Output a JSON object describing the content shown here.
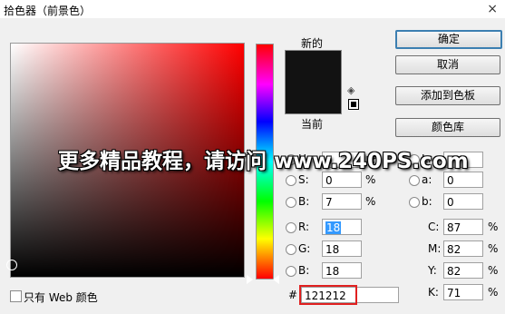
{
  "window": {
    "title": "拾色器（前景色）",
    "close_glyph": "×"
  },
  "preview": {
    "new_label": "新的",
    "current_label": "当前",
    "new_color": "#121212",
    "current_color": "#121212"
  },
  "buttons": {
    "ok": "确定",
    "cancel": "取消",
    "add_swatch": "添加到色板",
    "libraries": "颜色库"
  },
  "hsb": {
    "h_label": "H:",
    "h_value": "0",
    "h_unit": "度",
    "s_label": "S:",
    "s_value": "0",
    "s_unit": "%",
    "b_label": "B:",
    "b_value": "7",
    "b_unit": "%"
  },
  "rgb": {
    "r_label": "R:",
    "r_value": "18",
    "g_label": "G:",
    "g_value": "18",
    "b_label": "B:",
    "b_value": "18"
  },
  "lab": {
    "l_label": "L:",
    "l_value": "6",
    "a_label": "a:",
    "a_value": "0",
    "b_label": "b:",
    "b_value": "0"
  },
  "cmyk": {
    "c_label": "C:",
    "c_value": "87",
    "m_label": "M:",
    "m_value": "82",
    "y_label": "Y:",
    "y_value": "82",
    "k_label": "K:",
    "k_value": "71",
    "unit": "%"
  },
  "hex": {
    "label": "#",
    "value": "121212"
  },
  "web_colors_only": {
    "label": "只有 Web 颜色",
    "checked": false
  },
  "watermark": "更多精品教程，请访问 www.240PS.com",
  "cube_icon": "◈"
}
